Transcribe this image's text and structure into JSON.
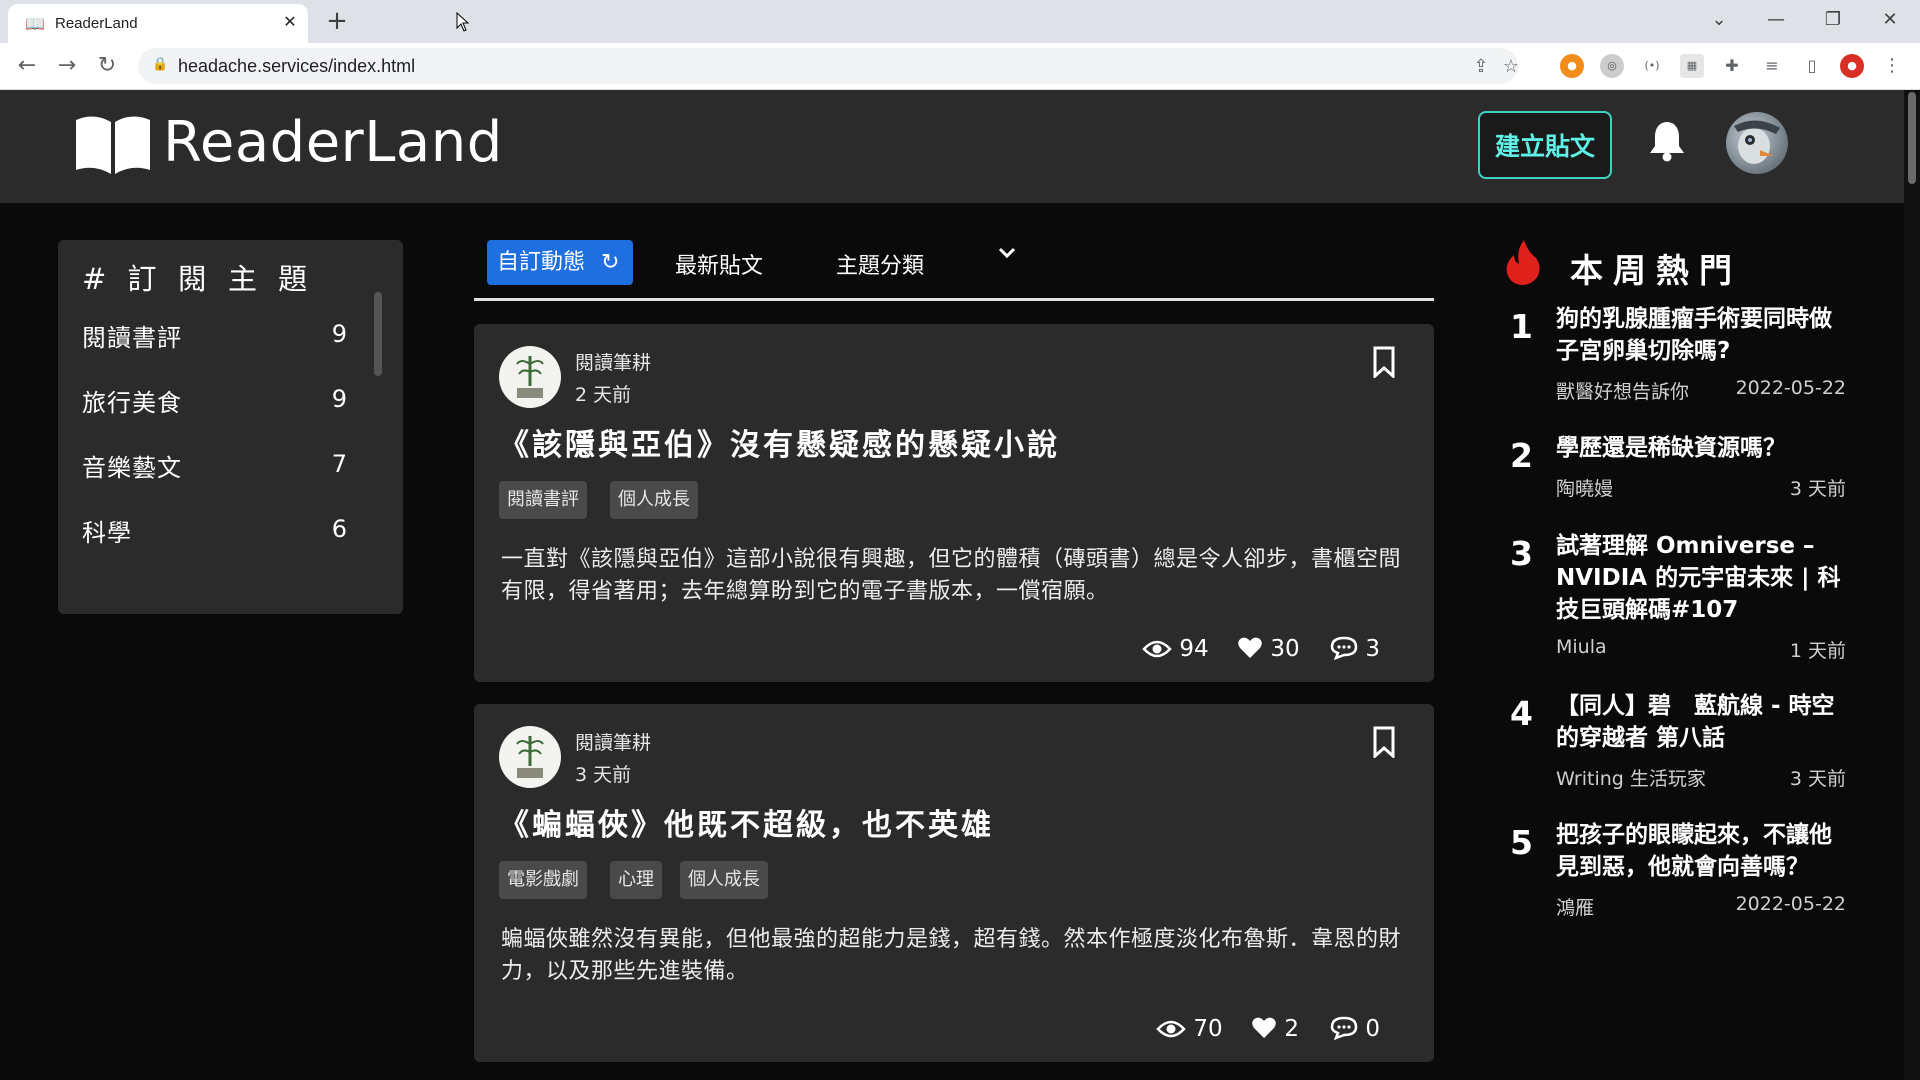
{
  "browser": {
    "tab_title": "ReaderLand",
    "url": "headache.services/index.html"
  },
  "header": {
    "logo_text": "ReaderLand",
    "create_post": "建立貼文"
  },
  "sidebar": {
    "title": "# 訂 閱 主 題",
    "items": [
      {
        "label": "閱讀書評",
        "count": "9"
      },
      {
        "label": "旅行美食",
        "count": "9"
      },
      {
        "label": "音樂藝文",
        "count": "7"
      },
      {
        "label": "科學",
        "count": "6"
      }
    ]
  },
  "feed": {
    "tabs": {
      "subscribed": "自訂動態",
      "latest": "最新貼文",
      "category": "主題分類"
    },
    "posts": [
      {
        "author": "閱讀筆耕",
        "time": "2 天前",
        "title": "《該隱與亞伯》沒有懸疑感的懸疑小說",
        "tags": [
          "閱讀書評",
          "個人成長"
        ],
        "body": "一直對《該隱與亞伯》這部小說很有興趣，但它的體積（磚頭書）總是令人卻步，書櫃空間有限，得省著用；去年總算盼到它的電子書版本，一償宿願。",
        "views": "94",
        "likes": "30",
        "comments": "3"
      },
      {
        "author": "閱讀筆耕",
        "time": "3 天前",
        "title": "《蝙蝠俠》他既不超級，也不英雄",
        "tags": [
          "電影戲劇",
          "心理",
          "個人成長"
        ],
        "body": "蝙蝠俠雖然沒有異能，但他最強的超能力是錢，超有錢。然本作極度淡化布魯斯．韋恩的財力，以及那些先進裝備。",
        "views": "70",
        "likes": "2",
        "comments": "0"
      }
    ]
  },
  "hot": {
    "title": "本周熱門",
    "items": [
      {
        "rank": "1",
        "title": "狗的乳腺腫瘤手術要同時做子宮卵巢切除嗎?",
        "author": "獸醫好想告訴你",
        "date": "2022-05-22"
      },
      {
        "rank": "2",
        "title": "學歷還是稀缺資源嗎？",
        "author": "陶曉嫚",
        "date": "3 天前"
      },
      {
        "rank": "3",
        "title": "試著理解 Omniverse – NVIDIA 的元宇宙未來 | 科技巨頭解碼#107",
        "author": "Miula",
        "date": "1 天前"
      },
      {
        "rank": "4",
        "title": "【同人】碧　藍航線 - 時空的穿越者 第八話",
        "author": "Writing 生活玩家",
        "date": "3 天前"
      },
      {
        "rank": "5",
        "title": "把孩子的眼矇起來，不讓他見到惡，他就會向善嗎？",
        "author": "鴻雁",
        "date": "2022-05-22"
      }
    ]
  },
  "colors": {
    "accent_blue": "#1f6fe0",
    "create_button_teal": "#3fd0c4",
    "flame_red": "#e0201a",
    "card_bg": "#2b2b2b",
    "page_bg": "#0a0a0a"
  },
  "icons": [
    "book-icon",
    "bell-icon",
    "refresh-icon",
    "chevron-down-icon",
    "bookmark-icon",
    "eye-icon",
    "heart-icon",
    "comment-icon",
    "flame-icon"
  ]
}
